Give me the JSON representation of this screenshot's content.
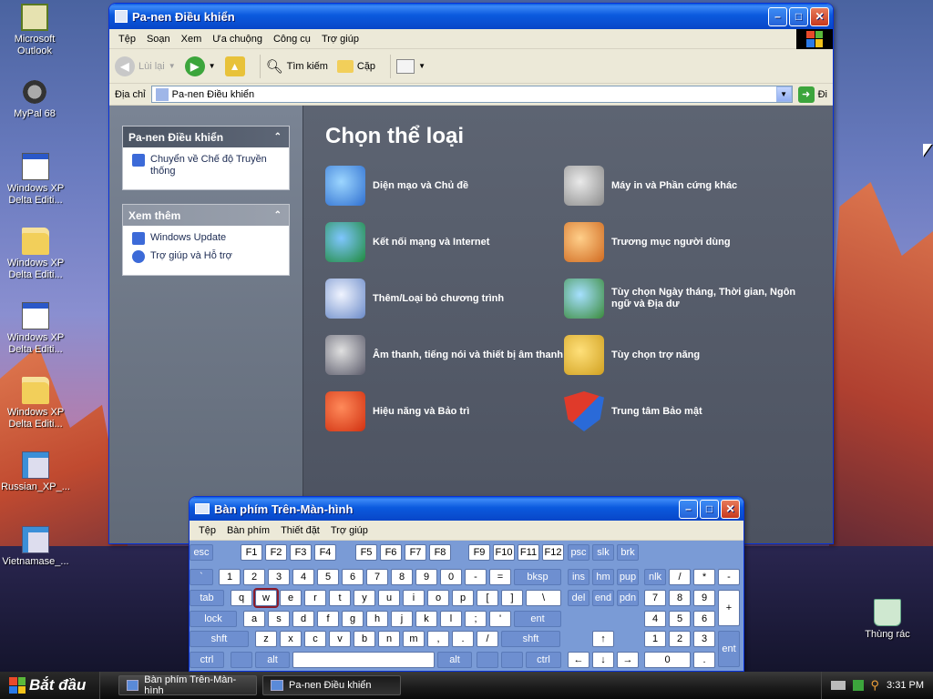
{
  "desktop": {
    "icons": [
      {
        "label": "Microsoft Outlook",
        "icon": "outlook-icon"
      },
      {
        "label": "MyPal 68",
        "icon": "raccoon-icon"
      },
      {
        "label": "Windows XP Delta Editi...",
        "icon": "document-icon"
      },
      {
        "label": "Windows XP Delta Editi...",
        "icon": "folder-icon"
      },
      {
        "label": "Windows XP Delta Editi...",
        "icon": "document-icon"
      },
      {
        "label": "Windows XP Delta Editi...",
        "icon": "folder-icon"
      },
      {
        "label": "Russian_XP_...",
        "icon": "setup-icon"
      },
      {
        "label": "Vietnamase_...",
        "icon": "setup-icon"
      },
      {
        "label": "Thùng rác",
        "icon": "recycle-bin-icon"
      }
    ]
  },
  "control_panel": {
    "title": "Pa-nen Điều khiển",
    "menu": [
      "Tệp",
      "Soạn",
      "Xem",
      "Ưa chuộng",
      "Công cụ",
      "Trợ giúp"
    ],
    "toolbar": {
      "back": "Lùi lại",
      "search": "Tìm kiếm",
      "folders": "Cặp"
    },
    "address": {
      "label": "Địa chỉ",
      "value": "Pa-nen Điều khiển",
      "go": "Đi"
    },
    "taskpane": {
      "panel1_title": "Pa-nen Điều khiển",
      "panel1_items": [
        "Chuyển về Chế độ Truyền thống"
      ],
      "panel2_title": "Xem thêm",
      "panel2_items": [
        "Windows Update",
        "Trợ giúp và Hỗ trợ"
      ]
    },
    "heading": "Chọn thể loại",
    "categories": [
      "Diện mạo và Chủ đề",
      "Máy in và Phần cứng khác",
      "Kết nối mạng và Internet",
      "Trương mục người dùng",
      "Thêm/Loại bỏ chương trình",
      "Tùy chọn Ngày tháng, Thời gian, Ngôn ngữ và Địa dư",
      "Âm thanh, tiếng nói và thiết bị âm thanh",
      "Tùy chọn trợ năng",
      "Hiệu năng và Bảo trì",
      "Trung tâm Bảo mật"
    ]
  },
  "keyboard": {
    "title": "Bàn phím Trên-Màn-hình",
    "menu": [
      "Tệp",
      "Bàn phím",
      "Thiết đặt",
      "Trợ giúp"
    ],
    "selected_key": "w",
    "rows": [
      [
        "esc",
        "F1",
        "F2",
        "F3",
        "F4",
        "F5",
        "F6",
        "F7",
        "F8",
        "F9",
        "F10",
        "F11",
        "F12",
        "psc",
        "slk",
        "brk"
      ],
      [
        "`",
        "1",
        "2",
        "3",
        "4",
        "5",
        "6",
        "7",
        "8",
        "9",
        "0",
        "-",
        "=",
        "bksp",
        "ins",
        "hm",
        "pup",
        "nlk",
        "/",
        "*",
        "-"
      ],
      [
        "tab",
        "q",
        "w",
        "e",
        "r",
        "t",
        "y",
        "u",
        "i",
        "o",
        "p",
        "[",
        "]",
        "\\",
        "del",
        "end",
        "pdn",
        "7",
        "8",
        "9",
        "+"
      ],
      [
        "lock",
        "a",
        "s",
        "d",
        "f",
        "g",
        "h",
        "j",
        "k",
        "l",
        ";",
        "'",
        "ent",
        "4",
        "5",
        "6"
      ],
      [
        "shft",
        "z",
        "x",
        "c",
        "v",
        "b",
        "n",
        "m",
        ",",
        ".",
        "/",
        "shft",
        "↑",
        "1",
        "2",
        "3",
        "ent"
      ],
      [
        "ctrl",
        "alt",
        "alt",
        "ctrl",
        "←",
        "↓",
        "→",
        "0",
        "."
      ]
    ]
  },
  "taskbar": {
    "start": "Bắt đầu",
    "tasks": [
      "Bàn phím Trên-Màn-hình",
      "Pa-nen Điều khiển"
    ],
    "time": "3:31 PM"
  }
}
